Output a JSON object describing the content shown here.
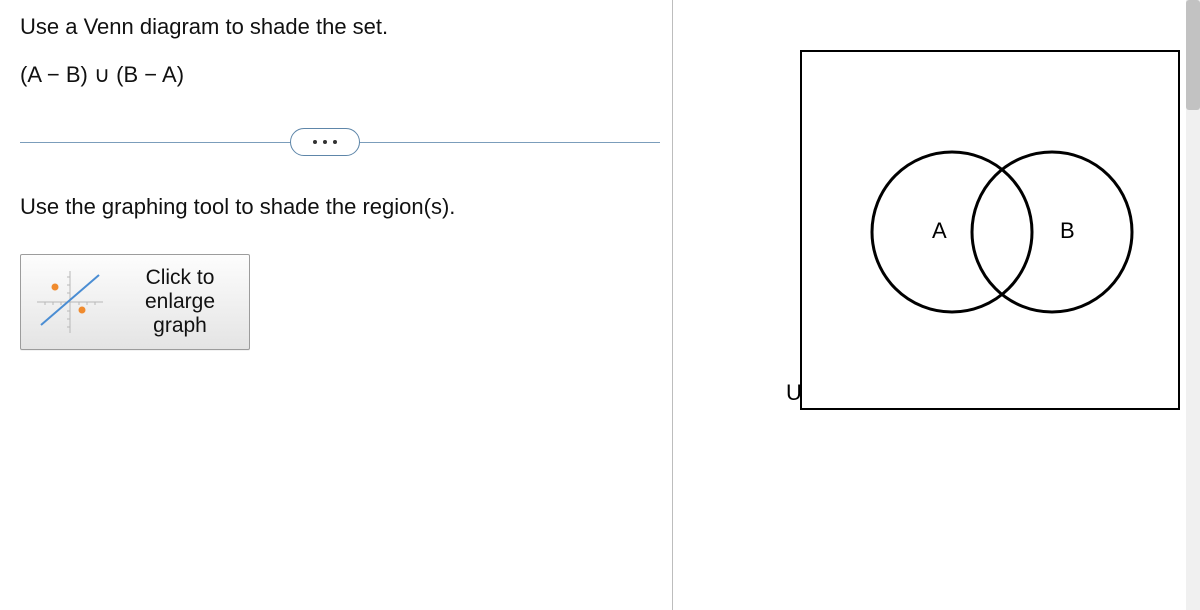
{
  "question": {
    "instruction_line1": "Use a Venn diagram to shade the set.",
    "expression": "(A − B) ∪ (B − A)",
    "instruction_line2": "Use the graphing tool to shade the region(s).",
    "enlarge_button": "Click to enlarge graph"
  },
  "venn": {
    "universe_label": "U",
    "set_a_label": "A",
    "set_b_label": "B"
  },
  "icons": {
    "more": "more-icon",
    "graph_thumb": "graph-thumb-icon"
  }
}
